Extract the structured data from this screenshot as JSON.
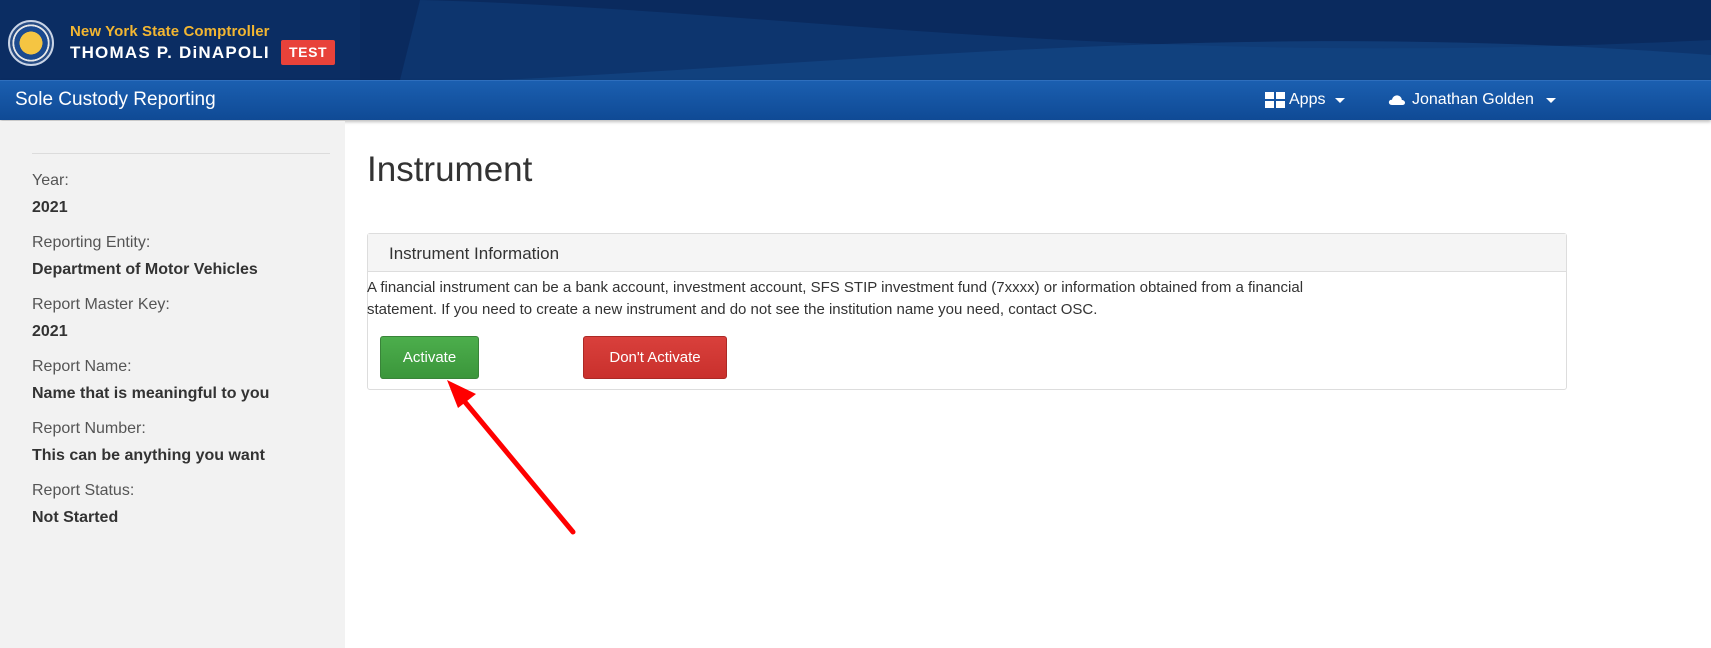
{
  "header": {
    "agency": "New York State Comptroller",
    "name": "THOMAS P. DiNAPOLI",
    "env_badge": "TEST"
  },
  "navbar": {
    "app_title": "Sole Custody Reporting",
    "apps_label": "Apps",
    "user_label": "Jonathan Golden"
  },
  "sidebar": {
    "items": [
      {
        "label": "Year:",
        "value": "2021"
      },
      {
        "label": "Reporting Entity:",
        "value": "Department of Motor Vehicles"
      },
      {
        "label": "Report Master Key:",
        "value": "2021"
      },
      {
        "label": "Report Name:",
        "value": "Name that is meaningful to you"
      },
      {
        "label": "Report Number:",
        "value": "This can be anything you want"
      },
      {
        "label": "Report Status:",
        "value": "Not Started"
      }
    ]
  },
  "main": {
    "page_title": "Instrument",
    "panel": {
      "heading": "Instrument Information",
      "body_line1": "A financial instrument can be a bank account, investment account, SFS STIP investment fund (7xxxx) or information obtained from a financial",
      "body_line2": "statement. If you need to create a new instrument and do not see the institution name you need, contact OSC.",
      "activate_label": "Activate",
      "dont_activate_label": "Don't Activate"
    }
  },
  "colors": {
    "banner": "#0a2a5e",
    "navbar": "#1557a6",
    "activate": "#449d44",
    "dont_activate": "#d9403c",
    "annotation_arrow": "#ff0000",
    "test_badge": "#e8423a"
  }
}
